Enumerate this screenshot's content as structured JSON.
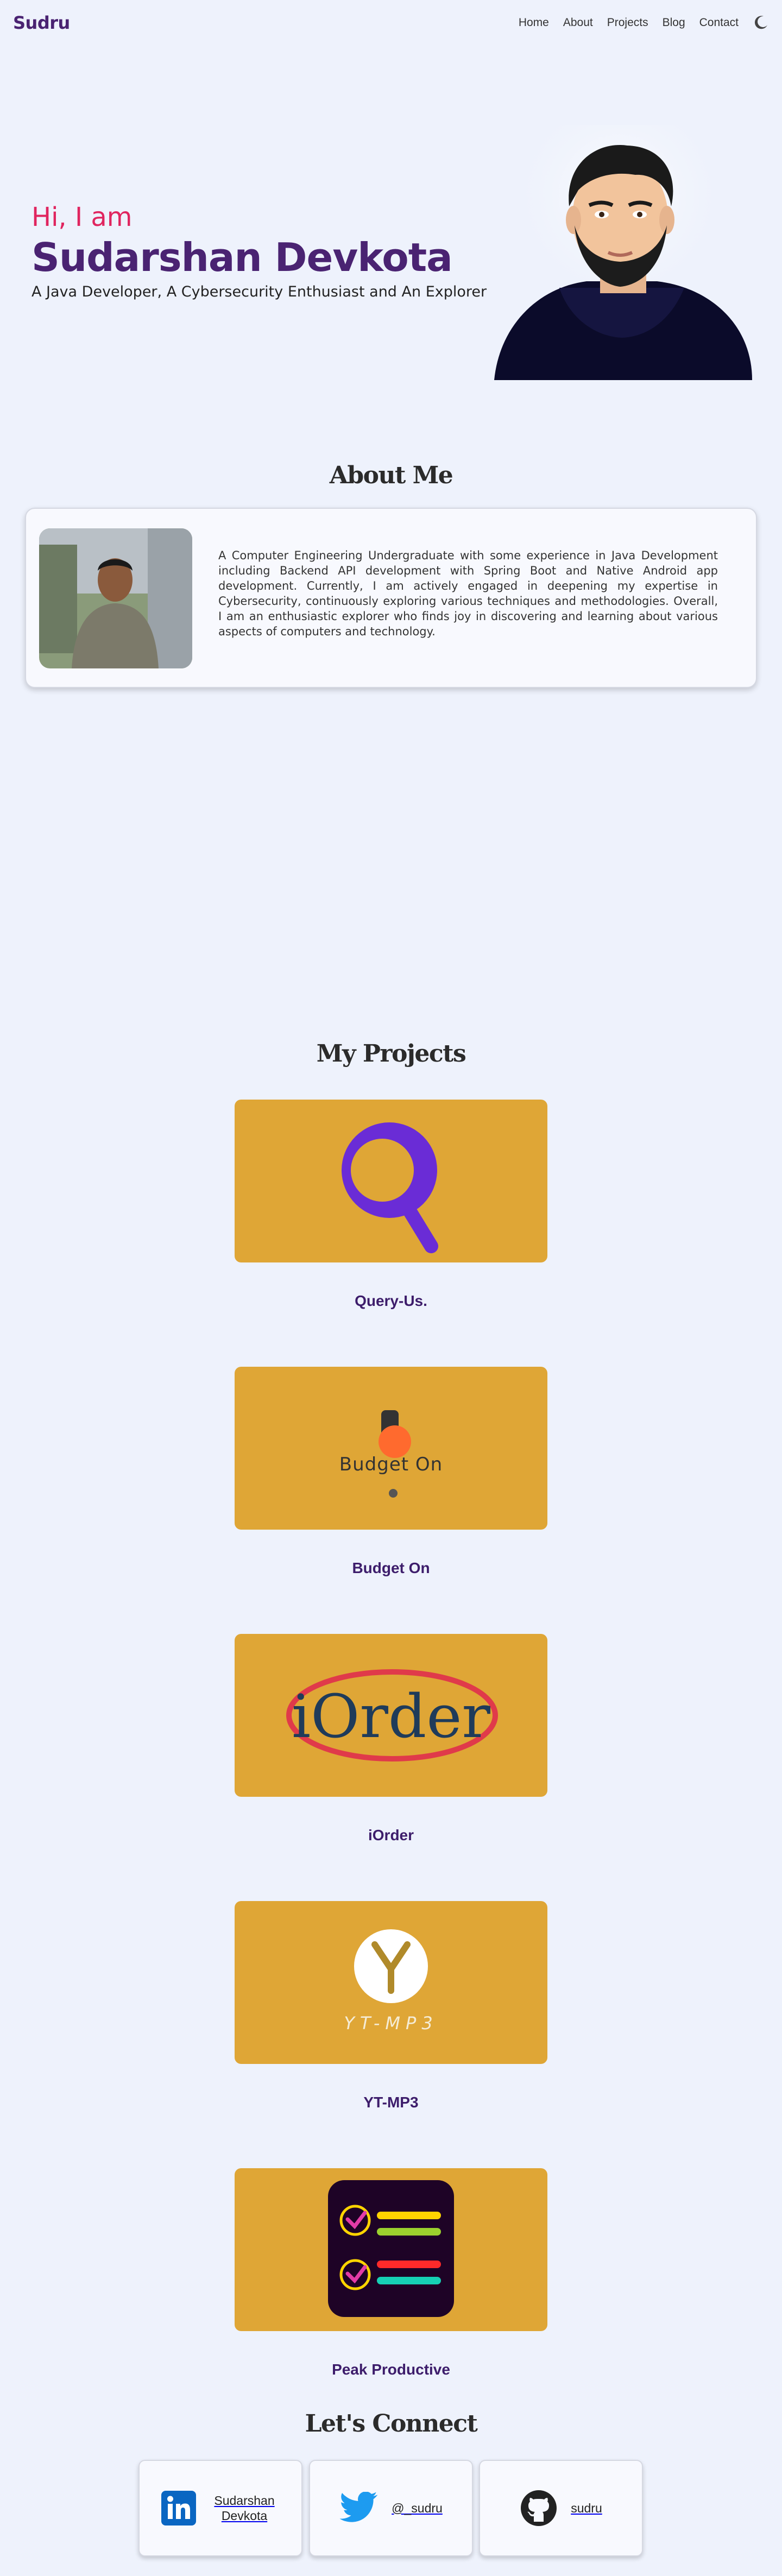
{
  "nav": {
    "brand": "Sudru",
    "links": [
      "Home",
      "About",
      "Projects",
      "Blog",
      "Contact"
    ],
    "theme_icon": "moon-icon"
  },
  "hero": {
    "greeting": "Hi, I am",
    "name": "Sudarshan Devkota",
    "tagline": "A Java Developer, A Cybersecurity Enthusiast and An Explorer"
  },
  "about": {
    "title": "About Me",
    "text": "A Computer Engineering Undergraduate with some experience in Java Development including Backend API development with Spring Boot and Native Android app development. Currently, I am actively engaged in deepening my expertise in Cybersecurity, continuously exploring various techniques and methodologies. Overall, I am an enthusiastic explorer who finds joy in discovering and learning about various aspects of computers and technology."
  },
  "projects": {
    "title": "My Projects",
    "items": [
      {
        "name": "Query-Us."
      },
      {
        "name": "Budget On",
        "logo_text": "Budget On"
      },
      {
        "name": "iOrder",
        "logo_text": "iOrder"
      },
      {
        "name": "YT-MP3",
        "logo_text": "YT-MP3"
      },
      {
        "name": "Peak Productive"
      }
    ]
  },
  "connect": {
    "title": "Let's Connect",
    "items": [
      {
        "label": "Sudarshan Devkota",
        "icon": "linkedin-icon"
      },
      {
        "label": "@_sudru",
        "icon": "twitter-icon"
      },
      {
        "label": "sudru",
        "icon": "github-icon"
      }
    ]
  },
  "colors": {
    "accent": "#e0255f",
    "brand": "#4a2372",
    "project_bg": "#dfa636",
    "page_bg": "#eef2fc"
  }
}
